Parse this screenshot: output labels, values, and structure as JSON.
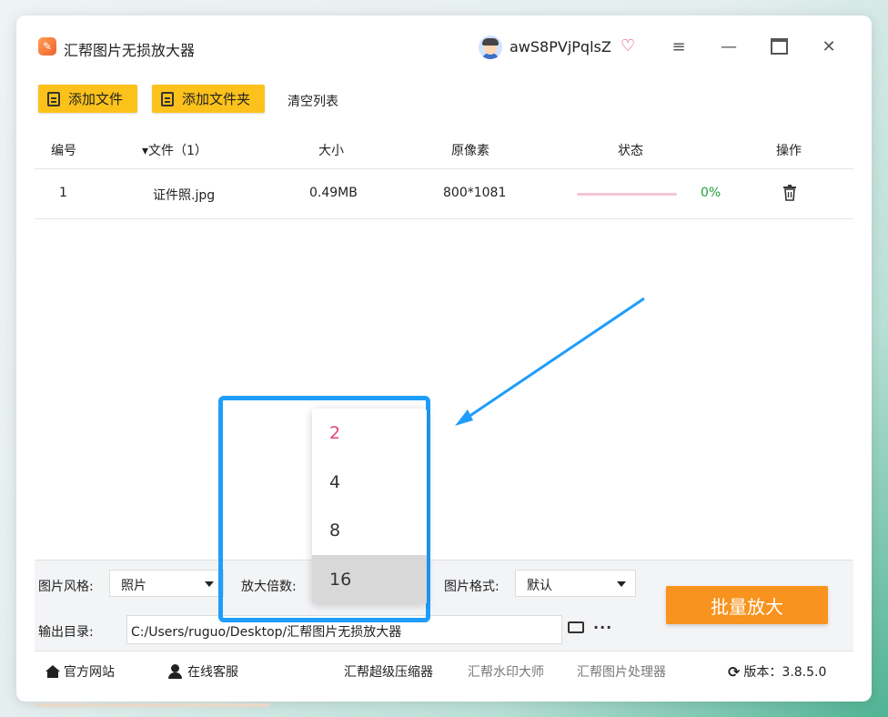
{
  "app": {
    "title": "汇帮图片无损放大器",
    "username": "awS8PVjPqlsZ",
    "icons": {
      "app": "app-logo-icon",
      "vip": "vip-heart-icon",
      "menu": "hamburger-icon",
      "minimize": "minimize-icon",
      "maximize": "maximize-icon",
      "close": "close-icon"
    }
  },
  "toolbar": {
    "add_file": "添加文件",
    "add_folder": "添加文件夹",
    "clear_list": "清空列表"
  },
  "table": {
    "headers": {
      "index": "编号",
      "file": "▾文件（1）",
      "size": "大小",
      "pixels": "原像素",
      "status": "状态",
      "action": "操作"
    },
    "rows": [
      {
        "index": "1",
        "name": "证件照.jpg",
        "size": "0.49MB",
        "pixels": "800*1081",
        "progress_percent": 0,
        "status": "0%"
      }
    ]
  },
  "dropdown": {
    "options": [
      "2",
      "4",
      "8",
      "16"
    ],
    "selected": "2",
    "hovered": "16"
  },
  "settings": {
    "style_label": "图片风格:",
    "style_value": "照片",
    "scale_label": "放大倍数:",
    "format_label": "图片格式:",
    "format_value": "默认",
    "output_label": "输出目录:",
    "output_path": "C:/Users/ruguo/Desktop/汇帮图片无损放大器",
    "batch_button": "批量放大"
  },
  "footer": {
    "official_site": "官方网站",
    "online_service": "在线客服",
    "compressor": "汇帮超级压缩器",
    "watermark": "汇帮水印大师",
    "image_processor": "汇帮图片处理器",
    "version": "版本：3.8.5.0"
  },
  "colors": {
    "accent_yellow": "#fcc21b",
    "batch_orange": "#f7931e",
    "highlight_blue": "#1f9dfb",
    "selected_pink": "#e0457b",
    "status_green": "#1fa33c"
  }
}
